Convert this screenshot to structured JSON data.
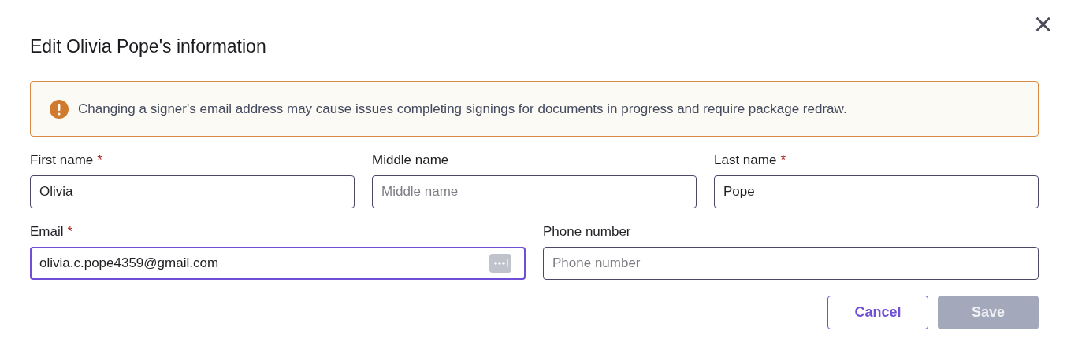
{
  "dialog": {
    "title": "Edit Olivia Pope's information",
    "close_label": "×"
  },
  "alert": {
    "kind": "warning",
    "message": "Changing a signer's email address may cause issues completing signings for documents in progress and require package redraw."
  },
  "field_rows": [
    [
      {
        "label": "First name",
        "required_mark": "*",
        "value": "Olivia",
        "focused": false
      },
      {
        "label": "Middle name",
        "placeholder": "Middle name",
        "focused": false
      },
      {
        "label": "Last name",
        "required_mark": "*",
        "value": "Pope",
        "focused": false
      }
    ],
    [
      {
        "label": "Email",
        "required_mark": "*",
        "value": "olivia.c.pope4359@gmail.com",
        "focused": true,
        "password_manager": true
      },
      {
        "label": "Phone number",
        "placeholder": "Phone number",
        "focused": false
      }
    ]
  ],
  "buttons": [
    {
      "label": "Cancel",
      "kind": "secondary",
      "disabled": false
    },
    {
      "label": "Save",
      "kind": "primary",
      "disabled": true
    }
  ]
}
